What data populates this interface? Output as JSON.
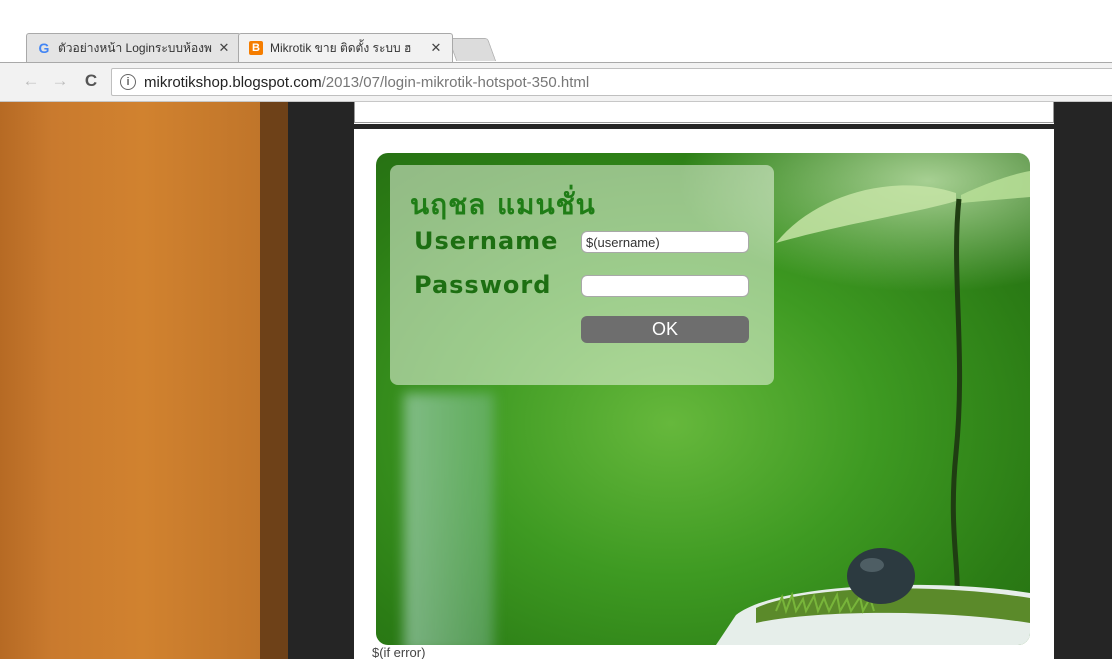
{
  "browser": {
    "tabs": [
      {
        "title": "ตัวอย่างหน้า Loginระบบห้องพ",
        "favicon": "google-g-icon",
        "active": false
      },
      {
        "title": "Mikrotik ขาย ติดตั้ง ระบบ ฮ",
        "favicon": "blogger-icon",
        "active": true
      }
    ],
    "close_glyph": "✕",
    "nav": {
      "back": "←",
      "forward": "→",
      "reload": "C"
    },
    "info_glyph": "i",
    "url": {
      "host": "mikrotikshop.blogspot.com",
      "path": "/2013/07/login-mikrotik-hotspot-350.html"
    }
  },
  "login": {
    "brand": "นฤชล  แมนชั่น",
    "username_label": "Username",
    "password_label": "Password",
    "username_value": "$(username)",
    "password_value": "",
    "ok_label": "OK"
  },
  "error_text": "$(if error)",
  "colors": {
    "label_green": "#1d6f12",
    "button_gray": "#6e6e6e",
    "blogger_orange": "#f57d00",
    "side_orange": "#c97a2e"
  }
}
